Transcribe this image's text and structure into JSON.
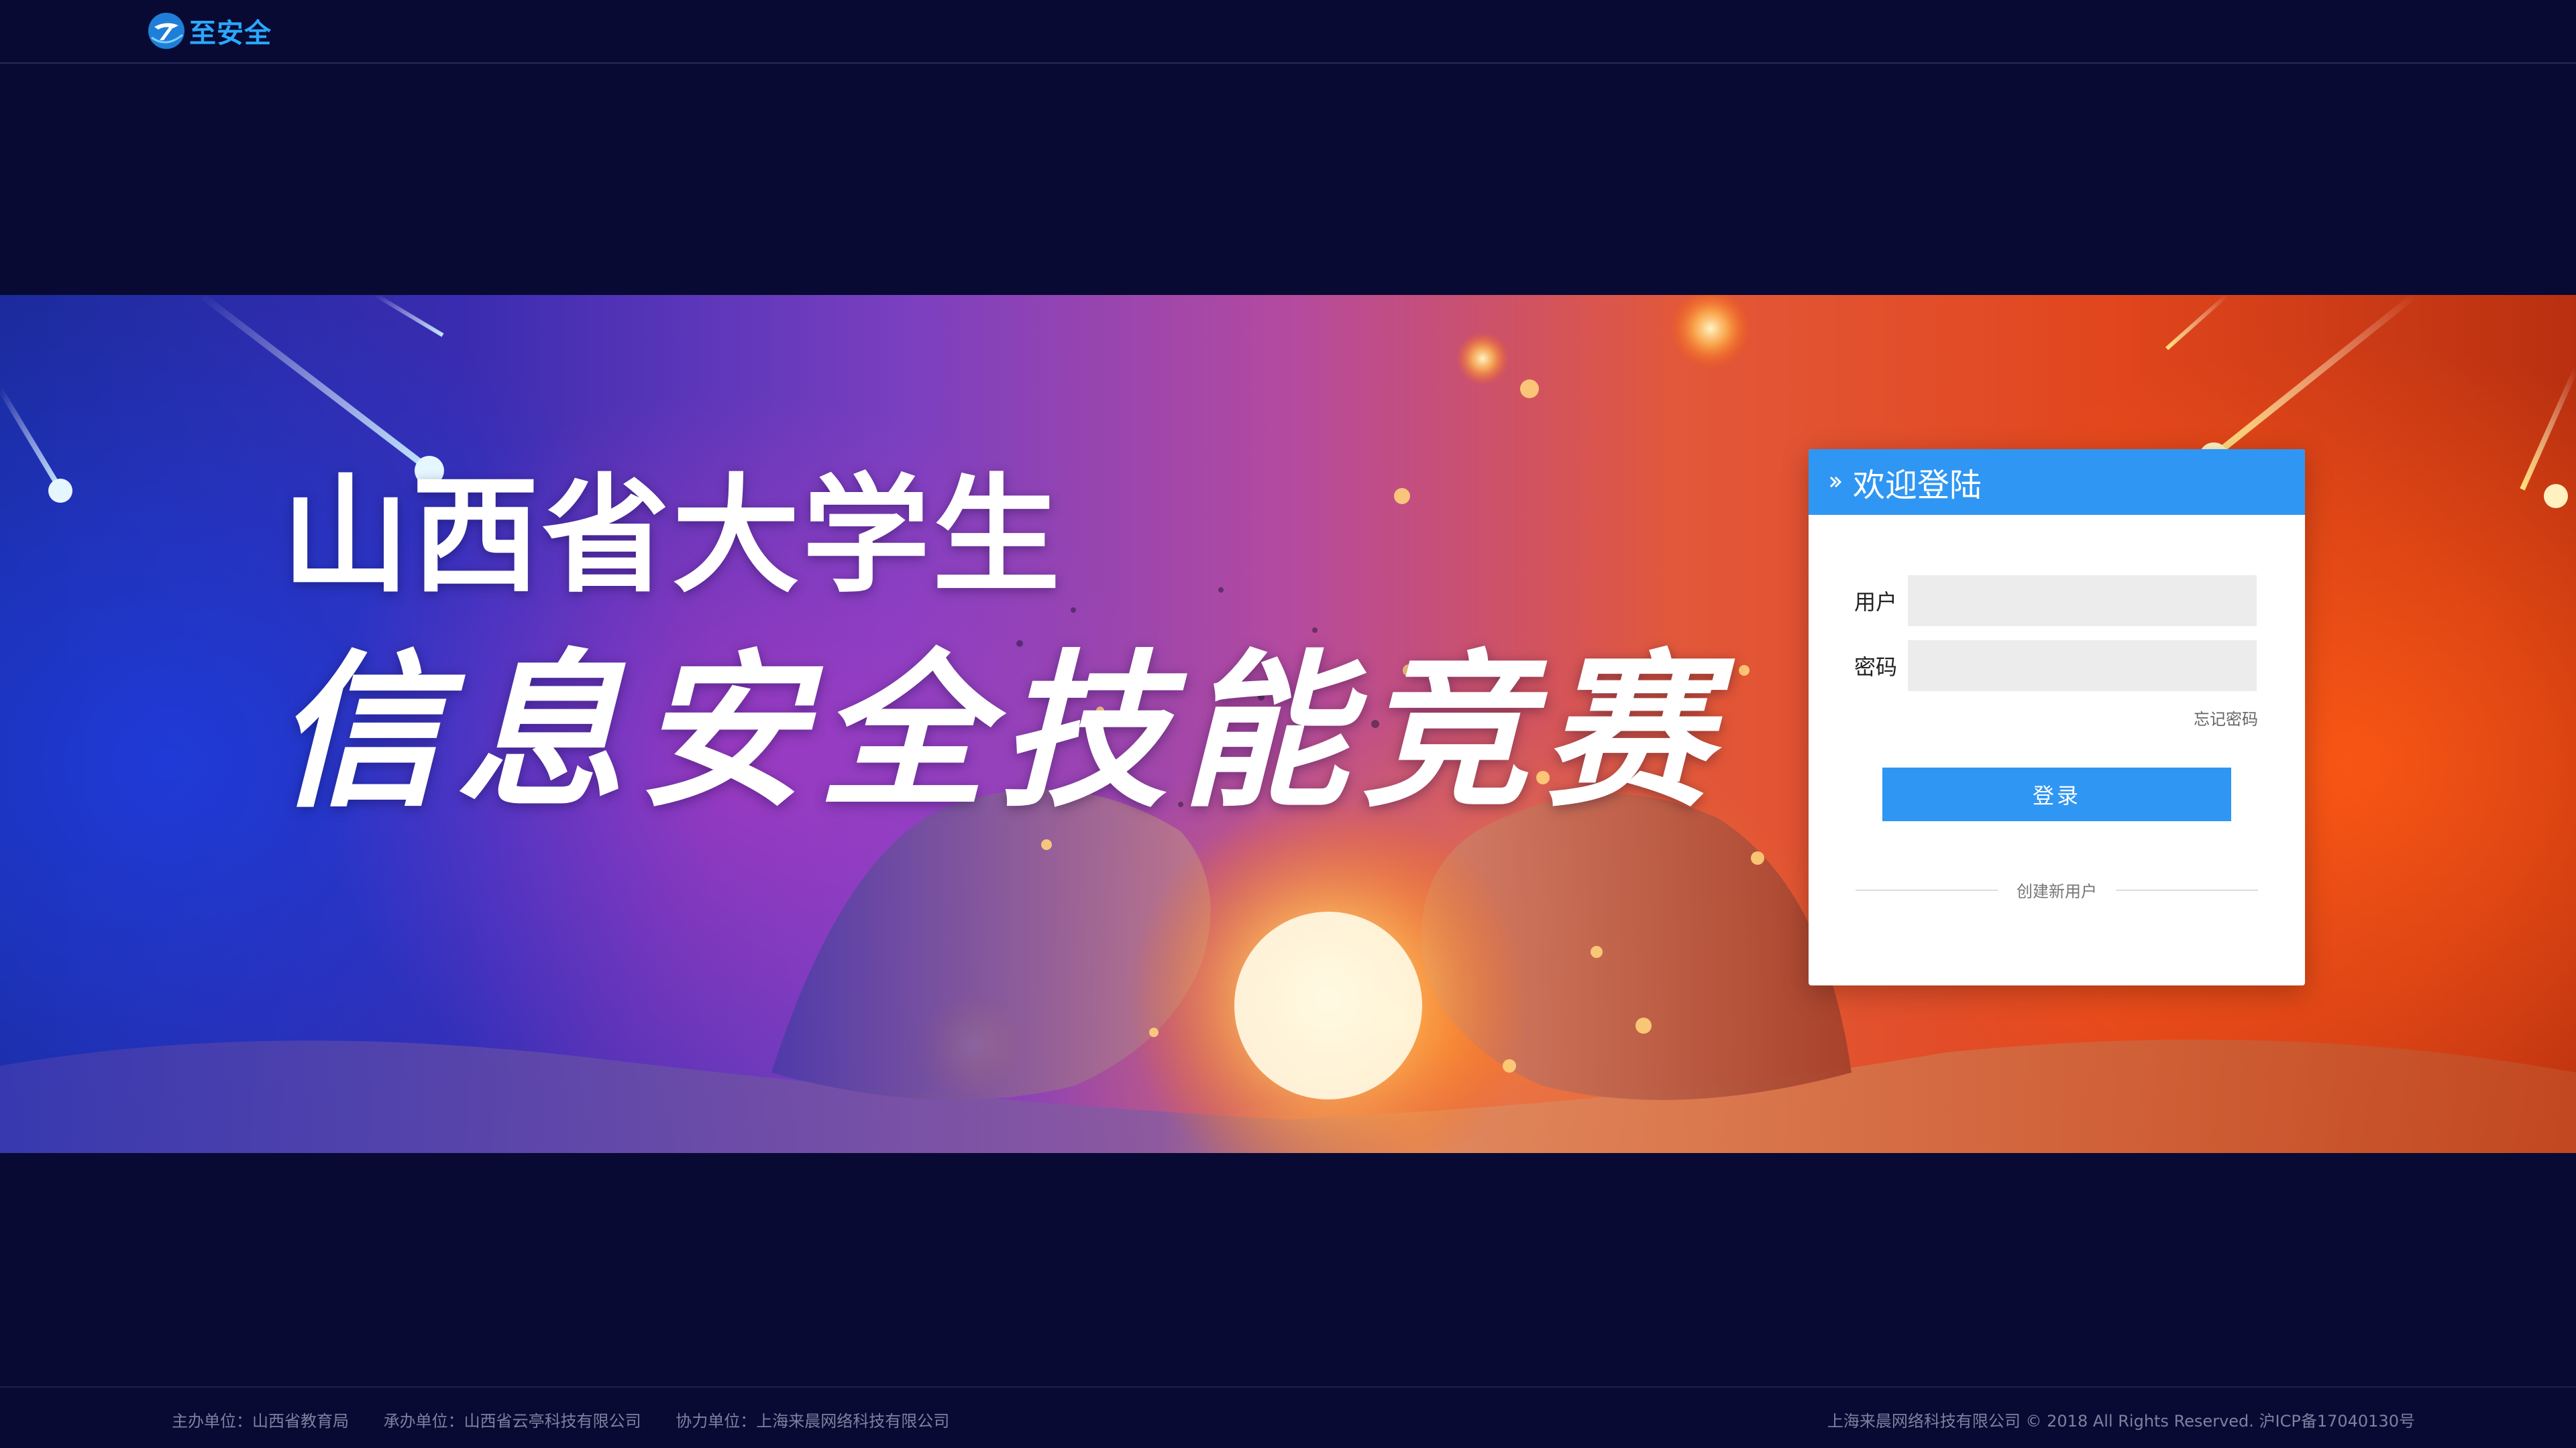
{
  "header": {
    "logo_text": "至安全"
  },
  "banner": {
    "title_line1": "山西省大学生",
    "title_line2": "信息安全技能竞赛"
  },
  "login": {
    "title": "欢迎登陆",
    "username_label": "用户",
    "username_value": "",
    "password_label": "密码",
    "password_value": "",
    "forgot_password": "忘记密码",
    "submit_label": "登录",
    "create_user": "创建新用户"
  },
  "footer": {
    "sponsor": "主办单位：山西省教育局",
    "organizer": "承办单位：山西省云亭科技有限公司",
    "cooperator": "协力单位：上海来晨网络科技有限公司",
    "copyright": "上海来晨网络科技有限公司 © 2018 All Rights Reserved.  沪ICP备17040130号"
  },
  "colors": {
    "page_bg": "#080a33",
    "accent": "#2f96f3",
    "logo_blue": "#2aa8ff"
  },
  "icons": {
    "logo": "brand-logo-icon",
    "login_header": "double-chevron-right-icon"
  }
}
